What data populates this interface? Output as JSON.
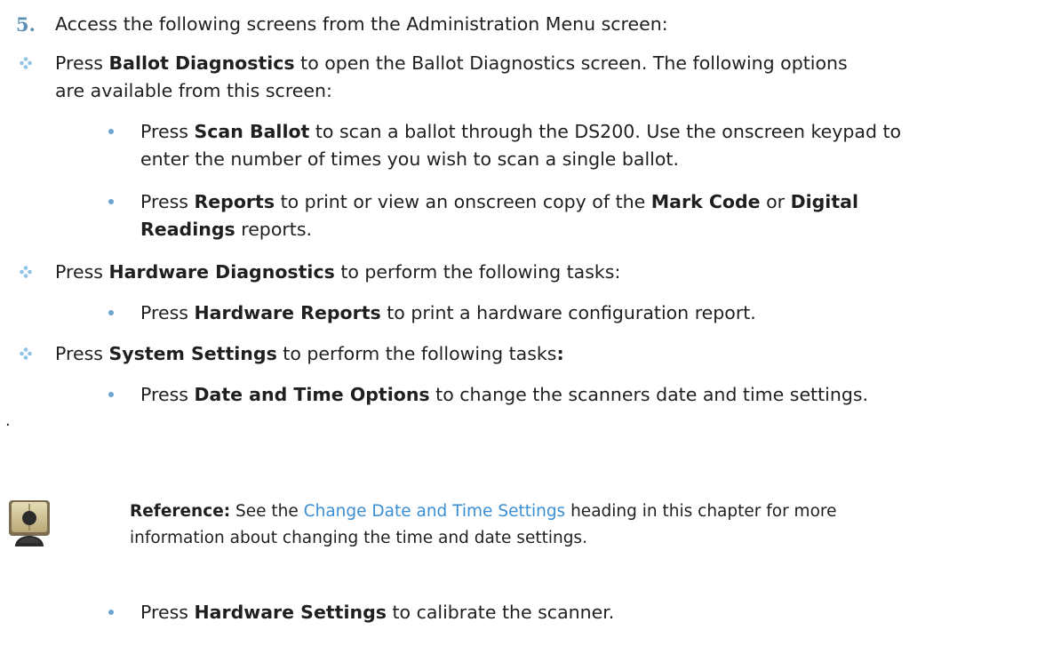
{
  "step": {
    "number": "5.",
    "text": "Access the following screens from the Administration Menu screen:"
  },
  "ballot": {
    "press": "Press ",
    "bold": "Ballot Diagnostics",
    "rest": " to open the Ballot Diagnostics screen. The following options",
    "line2": "are available from this screen:",
    "scan": {
      "press": "Press ",
      "bold": "Scan Ballot",
      "rest": " to scan a ballot through the DS200. Use the onscreen keypad to",
      "line2": "enter the number of times you wish to scan a single ballot."
    },
    "reports": {
      "press": "Press ",
      "bold": "Reports",
      "rest1": " to print or view an onscreen copy of the ",
      "bold2": "Mark Code",
      "rest2": " or ",
      "bold3": "Digital",
      "bold4": "Readings",
      "rest3": " reports."
    }
  },
  "hardware": {
    "press": "Press ",
    "bold": "Hardware Diagnostics",
    "rest": " to perform the following tasks:",
    "reports": {
      "press": "Press ",
      "bold": "Hardware Reports",
      "rest": " to print a hardware configuration report."
    }
  },
  "system": {
    "press": "Press ",
    "bold": "System Settings",
    "rest": " to perform the following tasks",
    "colon": ":",
    "datetime": {
      "press": "Press ",
      "bold": "Date and Time Options",
      "rest": " to change the scanners date and time settings."
    },
    "hwsettings": {
      "press": "Press ",
      "bold": "Hardware Settings",
      "rest": " to calibrate the scanner."
    }
  },
  "stray_mark": ".",
  "reference": {
    "label": "Reference:",
    "pre": " See the ",
    "link": "Change Date and Time Settings",
    "post": " heading in this chapter for more",
    "line2": "information about changing the time and date settings."
  },
  "colors": {
    "step_number": "#5a8fb3",
    "diamond": "#8fc4e8",
    "bullet": "#6ba3cf",
    "link": "#3a8fd4"
  },
  "icons": [
    "diamond-bullet-icon",
    "round-bullet-icon",
    "reference-book-icon"
  ]
}
